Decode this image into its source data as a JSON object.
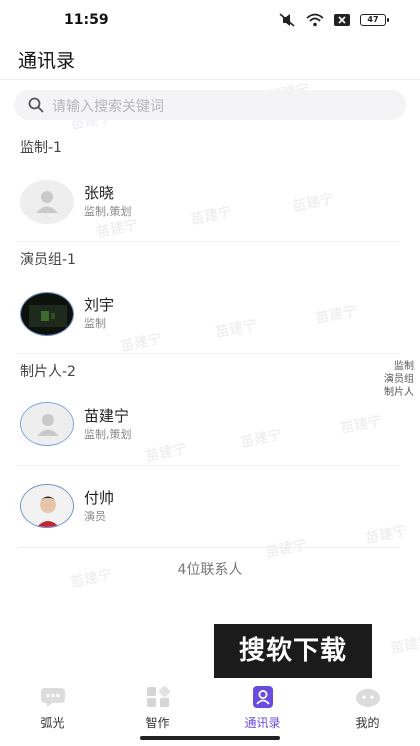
{
  "status": {
    "time": "11:59",
    "battery": "47"
  },
  "header": {
    "title": "通讯录"
  },
  "search": {
    "placeholder": "请输入搜索关键词"
  },
  "sections": [
    {
      "title": "监制-1",
      "contacts": [
        {
          "name": "张晓",
          "role": "监制,策划",
          "avatar": "default-avatar"
        }
      ]
    },
    {
      "title": "演员组-1",
      "contacts": [
        {
          "name": "刘宇",
          "role": "监制",
          "avatar": "photo-avatar"
        }
      ]
    },
    {
      "title": "制片人-2",
      "contacts": [
        {
          "name": "苗建宁",
          "role": "监制,策划",
          "avatar": "default-avatar"
        },
        {
          "name": "付帅",
          "role": "演员",
          "avatar": "photo-avatar"
        }
      ]
    }
  ],
  "index_bar": [
    "监制",
    "演员组",
    "制片人"
  ],
  "footer": {
    "count_text": "4位联系人"
  },
  "watermark": {
    "text": "苗建宁"
  },
  "badge": {
    "text": "搜软下载"
  },
  "tabs": [
    {
      "label": "弧光",
      "icon": "chat-bubble-icon"
    },
    {
      "label": "智作",
      "icon": "grid-icon"
    },
    {
      "label": "通讯录",
      "icon": "contacts-icon",
      "active": true
    },
    {
      "label": "我的",
      "icon": "profile-icon"
    }
  ],
  "colors": {
    "accent": "#6a4be0",
    "selected_ring": "#7aa2ea"
  }
}
